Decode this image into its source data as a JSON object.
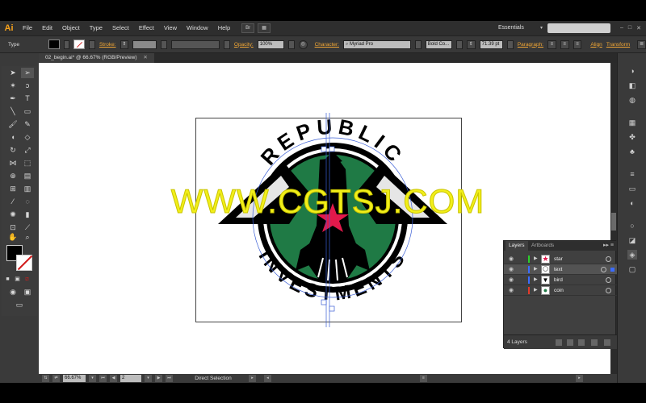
{
  "app": {
    "logo": "Ai"
  },
  "menu": {
    "items": [
      "File",
      "Edit",
      "Object",
      "Type",
      "Select",
      "Effect",
      "View",
      "Window",
      "Help"
    ],
    "bridge_label": "Br",
    "workspace": "Essentials"
  },
  "control_bar": {
    "selection_type": "Type",
    "stroke_label": "Stroke:",
    "opacity_label": "Opacity:",
    "opacity_value": "100%",
    "character_label": "Character:",
    "font_family": "Myriad Pro",
    "font_style": "Bold Co...",
    "font_size": "71.39 pt",
    "paragraph_label": "Paragraph:",
    "align_label": "Align",
    "transform_label": "Transform"
  },
  "document": {
    "tab_title": "02_begin.ai* @ 66.67% (RGB/Preview)"
  },
  "artwork": {
    "top_text": "REPUBLIC",
    "bottom_text": "INVESTMENTS",
    "colors": {
      "coin": "#1f7a45",
      "star": "#e2194b",
      "ink": "#000000"
    }
  },
  "watermark": "WWW.CGTSJ.COM",
  "status_bar": {
    "zoom": "66.67%",
    "artboard_number": "2",
    "current_tool": "Direct Selection"
  },
  "layers_panel": {
    "tabs": [
      "Layers",
      "Artboards"
    ],
    "layers": [
      {
        "name": "star",
        "color": "#2bd12b",
        "selected": false
      },
      {
        "name": "text",
        "color": "#3b6cff",
        "selected": true
      },
      {
        "name": "bird",
        "color": "#3b6cff",
        "selected": false
      },
      {
        "name": "coin",
        "color": "#e23a2a",
        "selected": false
      }
    ],
    "count_label": "4 Layers"
  },
  "colors": {
    "accent": "#f2a735",
    "app_bg": "#383838"
  }
}
